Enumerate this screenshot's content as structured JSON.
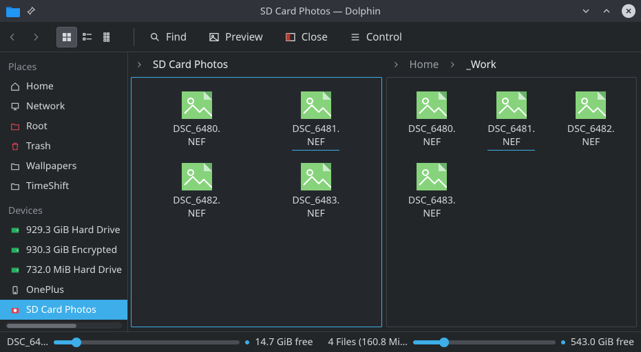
{
  "window": {
    "title": "SD Card Photos — Dolphin"
  },
  "toolbar": {
    "find": "Find",
    "preview": "Preview",
    "close": "Close",
    "control": "Control"
  },
  "sidebar": {
    "places_header": "Places",
    "places": [
      {
        "label": "Home",
        "icon": "home"
      },
      {
        "label": "Network",
        "icon": "network"
      },
      {
        "label": "Root",
        "icon": "root"
      },
      {
        "label": "Trash",
        "icon": "trash"
      },
      {
        "label": "Wallpapers",
        "icon": "folder"
      },
      {
        "label": "TimeShift",
        "icon": "folder"
      }
    ],
    "devices_header": "Devices",
    "devices": [
      {
        "label": "929.3 GiB Hard Drive",
        "icon": "drive"
      },
      {
        "label": "930.3 GiB Encrypted",
        "icon": "drive"
      },
      {
        "label": "732.0 MiB Hard Drive",
        "icon": "drive"
      },
      {
        "label": "OnePlus",
        "icon": "phone"
      },
      {
        "label": "SD Card Photos",
        "icon": "camera",
        "selected": true
      }
    ]
  },
  "breadcrumbs": {
    "left": [
      {
        "label": "SD Card Photos",
        "current": true
      }
    ],
    "right": [
      {
        "label": "Home"
      },
      {
        "label": "_Work",
        "current": true
      }
    ]
  },
  "panes": {
    "left": {
      "active": true,
      "files": [
        {
          "name": "DSC_6480.NEF"
        },
        {
          "name": "DSC_6481.NEF",
          "selected": true
        },
        {
          "name": "DSC_6482.NEF"
        },
        {
          "name": "DSC_6483.NEF"
        }
      ]
    },
    "right": {
      "files": [
        {
          "name": "DSC_6480.NEF"
        },
        {
          "name": "DSC_6481.NEF",
          "selected": true
        },
        {
          "name": "DSC_6482.NEF"
        },
        {
          "name": "DSC_6483.NEF"
        }
      ]
    }
  },
  "status": {
    "left_sel": "DSC_64…",
    "left_free": "14.7 GiB free",
    "right_info": "4 Files (160.8 Mi…",
    "right_free": "543.0 GiB free",
    "left_slider_pct": "12%",
    "right_slider_pct": "22%"
  },
  "colors": {
    "accent": "#3daee9",
    "thumb": "#87d37c"
  }
}
